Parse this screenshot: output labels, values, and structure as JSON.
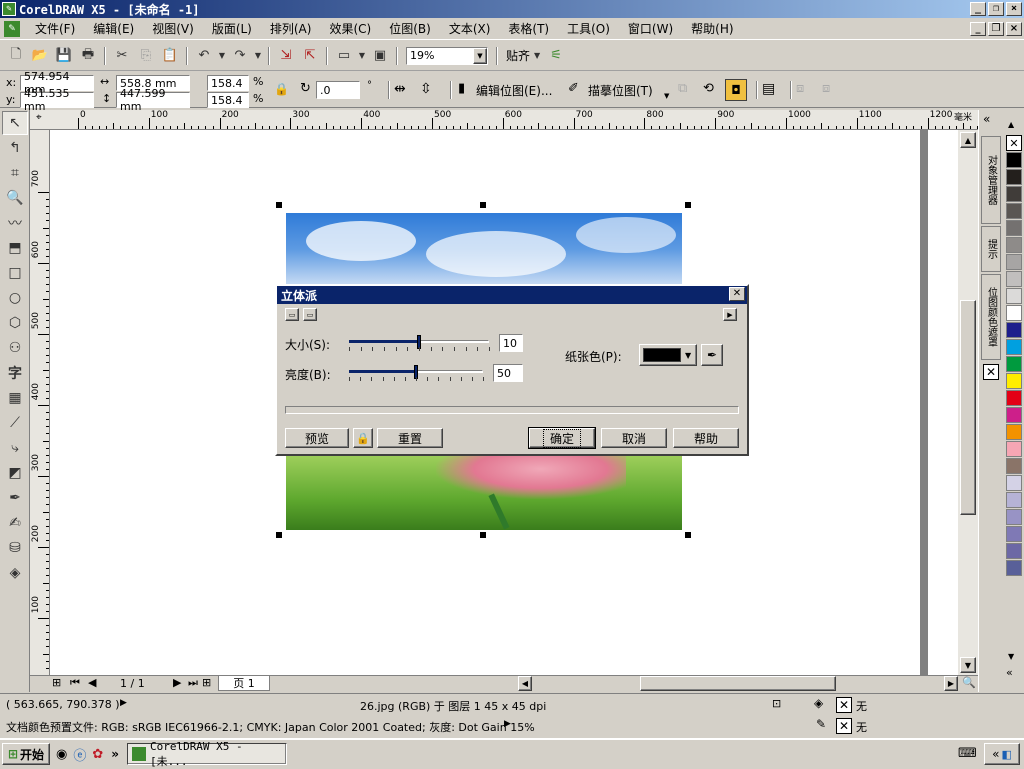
{
  "app": {
    "title": "CorelDRAW X5 - [未命名 -1]"
  },
  "menu": [
    "文件(F)",
    "编辑(E)",
    "视图(V)",
    "版面(L)",
    "排列(A)",
    "效果(C)",
    "位图(B)",
    "文本(X)",
    "表格(T)",
    "工具(O)",
    "窗口(W)",
    "帮助(H)"
  ],
  "toolbar": {
    "zoom": "19%",
    "snap_label": "贴齐"
  },
  "props": {
    "x_label": "x:",
    "y_label": "y:",
    "x": "574.954 mm",
    "y": "451.535 mm",
    "w": "558.8 mm",
    "h": "447.599 mm",
    "sx": "158.4",
    "sy": "158.4",
    "pct": "%",
    "angle": ".0",
    "deg": "°",
    "edit_bitmap": "编辑位图(E)...",
    "trace_bitmap": "描摹位图(T)"
  },
  "ruler": {
    "unit": "毫米",
    "h_ticks": [
      "0",
      "100",
      "200",
      "300",
      "400",
      "500",
      "600",
      "700",
      "800",
      "900",
      "1000",
      "1100",
      "1200"
    ],
    "v_ticks": [
      "700",
      "600",
      "500",
      "400",
      "300",
      "200",
      "100"
    ]
  },
  "page_nav": {
    "count": "1 / 1",
    "page_tab": "页 1"
  },
  "dockers": [
    "对象管理器",
    "提示",
    "位图颜色遮罩"
  ],
  "palette_colors": [
    "#ffffff",
    "#000000",
    "#231f1c",
    "#403c39",
    "#5a5653",
    "#747170",
    "#8e8b89",
    "#a7a5a4",
    "#c1bfbe",
    "#dbdad9",
    "#ffffff",
    "#1e1e8c",
    "#00a0e0",
    "#009a3e",
    "#ffed00",
    "#e30016",
    "#cd1f8a",
    "#f39200",
    "#f6a6b4",
    "#8a7468",
    "#d4d2e6",
    "#b6b3d6",
    "#9893c5",
    "#7f79b5",
    "#6c68a5",
    "#596099"
  ],
  "status": {
    "coords": "( 563.665, 790.378 )",
    "object_info": "26.jpg (RGB) 于 图层 1 45 x 45 dpi",
    "color_profile": "文档颜色预置文件: RGB: sRGB IEC61966-2.1; CMYK: Japan Color 2001 Coated; 灰度: Dot Gain 15%",
    "fill_none": "无",
    "outline_none": "无"
  },
  "taskbar": {
    "start": "开始",
    "task": "CorelDRAW X5 - [未...",
    "chevron": "»"
  },
  "dialog": {
    "title": "立体派",
    "size_label": "大小(S):",
    "size_value": "10",
    "brightness_label": "亮度(B):",
    "brightness_value": "50",
    "paper_color_label": "纸张色(P):",
    "paper_color": "#000000",
    "preview": "预览",
    "reset": "重置",
    "ok": "确定",
    "cancel": "取消",
    "help": "帮助",
    "size_level": 0.5,
    "brightness_level": 0.5
  }
}
